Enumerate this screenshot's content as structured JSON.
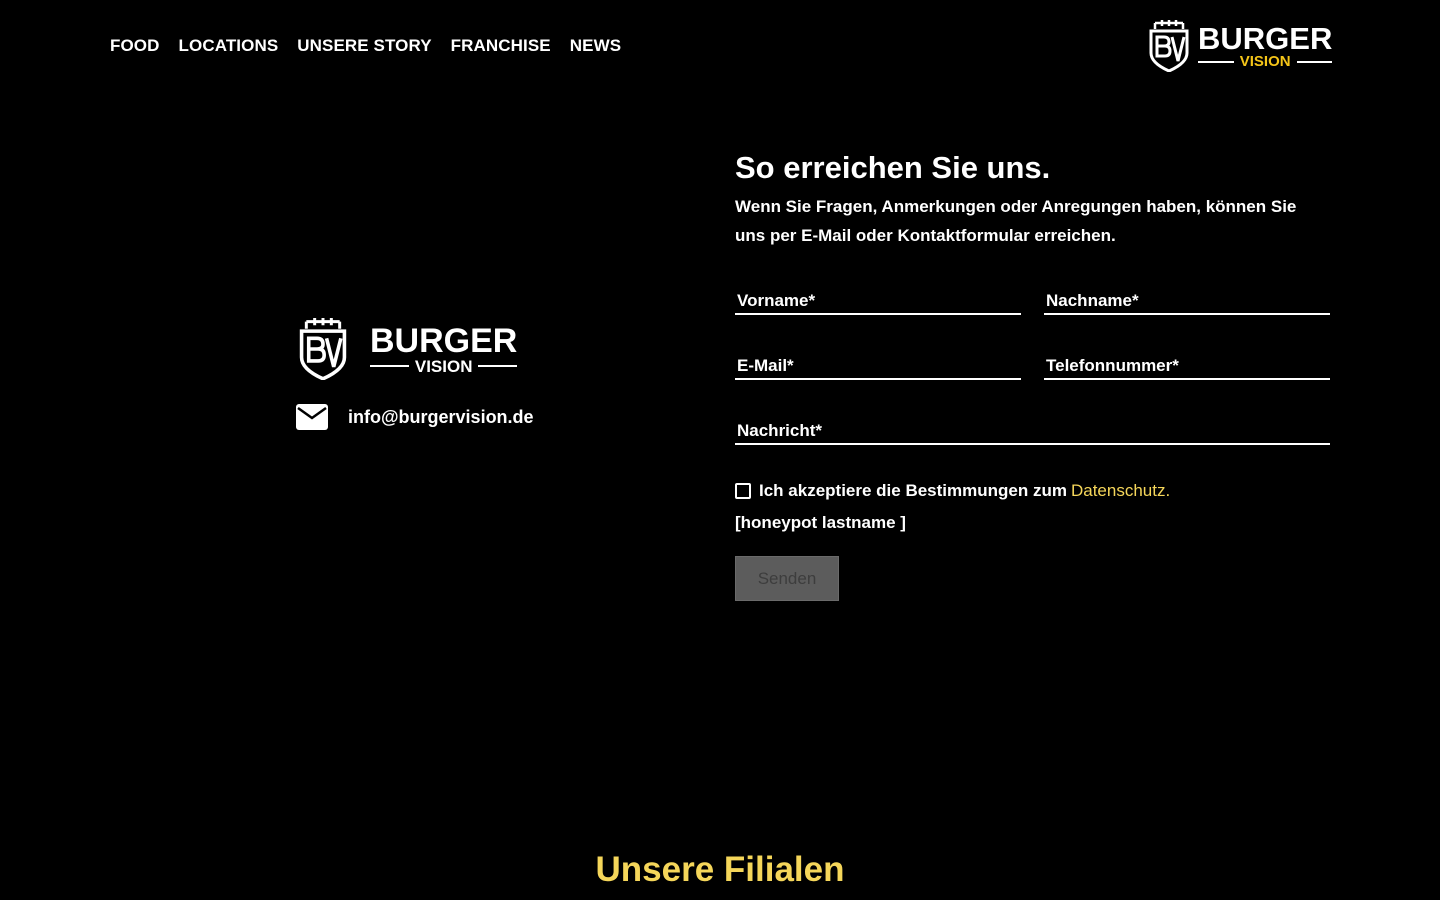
{
  "nav": {
    "items": [
      {
        "label": "FOOD"
      },
      {
        "label": "LOCATIONS"
      },
      {
        "label": "UNSERE STORY"
      },
      {
        "label": "FRANCHISE"
      },
      {
        "label": "NEWS"
      }
    ]
  },
  "logo": {
    "word": "BURGER",
    "sub": "VISION"
  },
  "contact_info": {
    "email": "info@burgervision.de"
  },
  "contact": {
    "title": "So erreichen Sie uns.",
    "intro": "Wenn Sie Fragen, Anmerkungen oder Anregungen haben, können Sie uns per E-Mail oder Kontaktformular erreichen.",
    "fields": {
      "firstname": "Vorname*",
      "lastname": "Nachname*",
      "email": "E-Mail*",
      "phone": "Telefonnummer*",
      "message": "Nachricht*"
    },
    "consent_text": "Ich akzeptiere die Bestimmungen zum",
    "consent_link": "Datenschutz.",
    "honeypot": "[honeypot lastname ]",
    "send_label": "Senden"
  },
  "filialen": {
    "title": "Unsere Filialen"
  },
  "colors": {
    "accent": "#f5d65a",
    "background": "#000000"
  }
}
